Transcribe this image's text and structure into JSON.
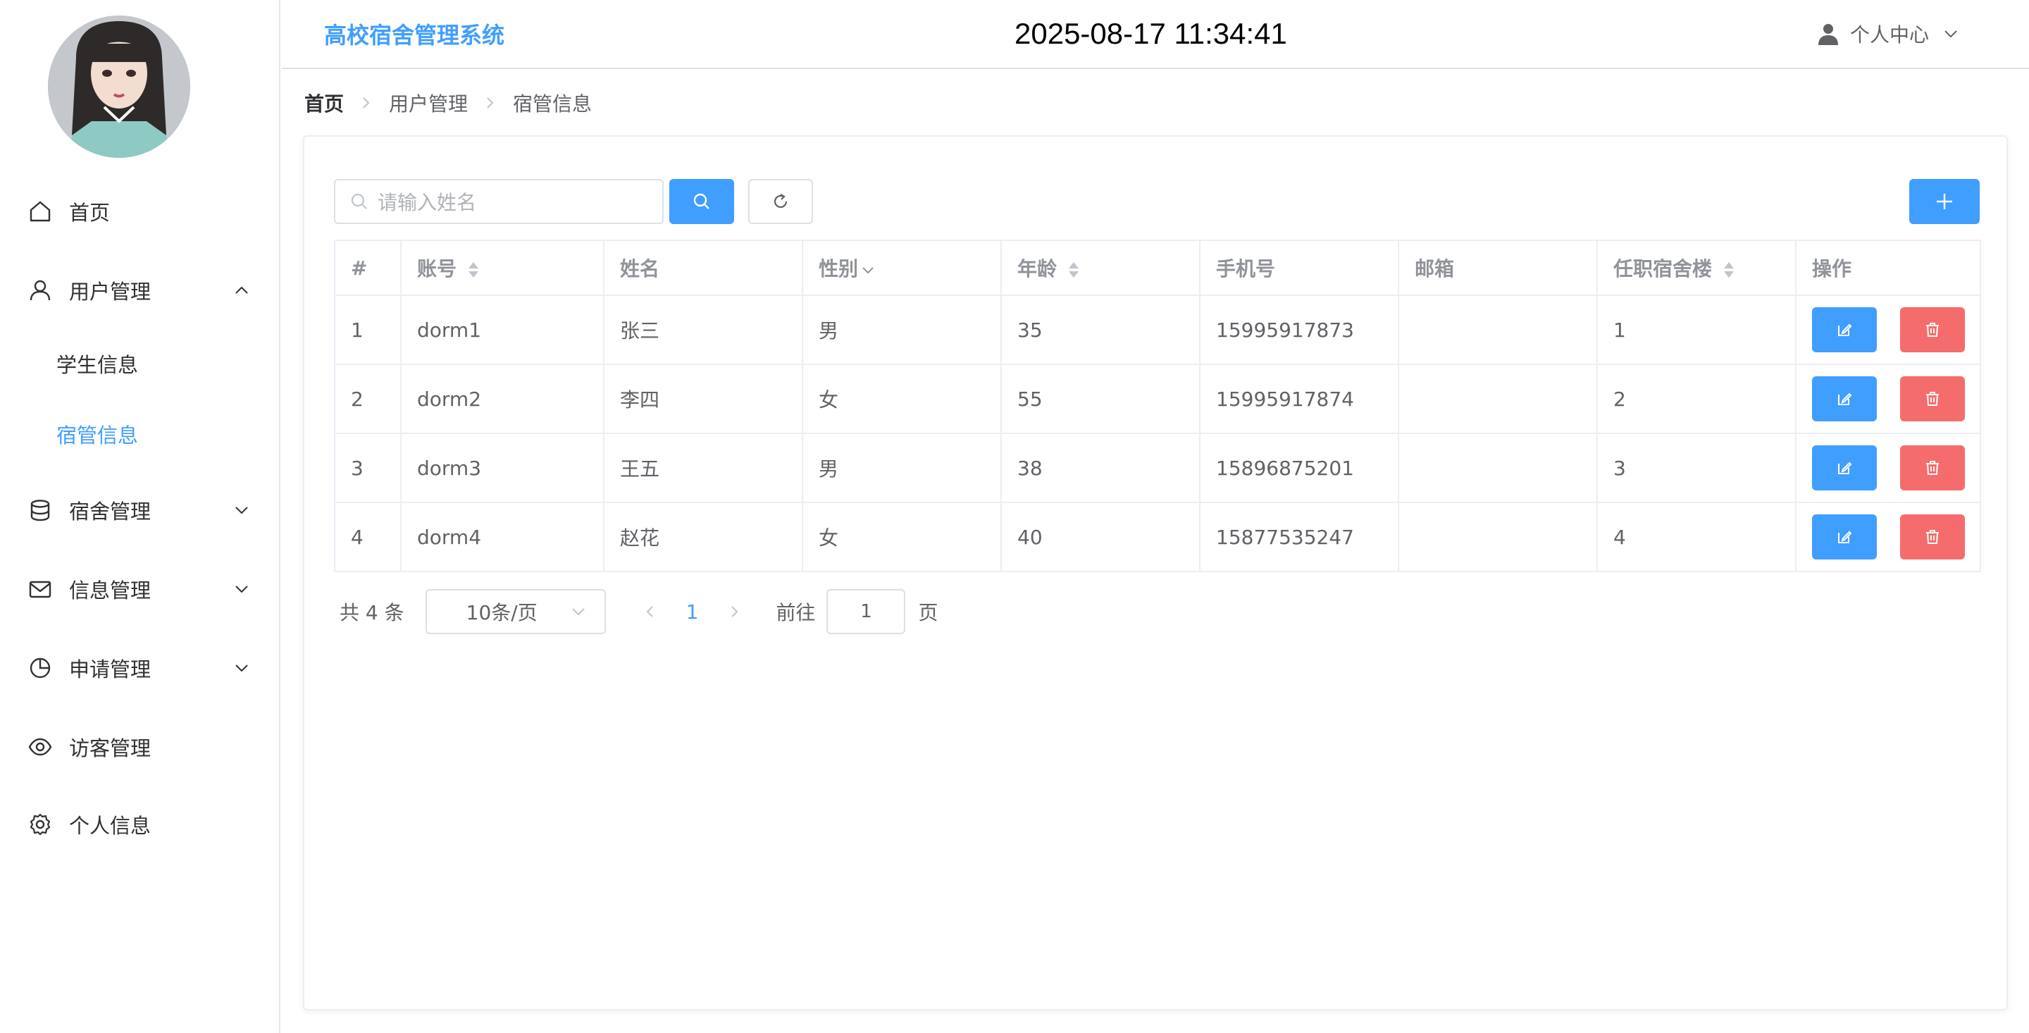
{
  "header": {
    "app_title": "高校宿舍管理系统",
    "clock": "2025-08-17 11:34:41",
    "user_menu": "个人中心"
  },
  "sidebar": {
    "items": [
      {
        "label": "首页",
        "icon": "home-icon"
      },
      {
        "label": "用户管理",
        "icon": "user-icon",
        "expanded": true
      },
      {
        "label": "宿舍管理",
        "icon": "database-icon"
      },
      {
        "label": "信息管理",
        "icon": "mail-icon"
      },
      {
        "label": "申请管理",
        "icon": "pie-chart-icon"
      },
      {
        "label": "访客管理",
        "icon": "eye-icon"
      },
      {
        "label": "个人信息",
        "icon": "gear-icon"
      }
    ],
    "sub_items": [
      {
        "label": "学生信息",
        "active": false
      },
      {
        "label": "宿管信息",
        "active": true
      }
    ]
  },
  "breadcrumb": {
    "home": "首页",
    "level1": "用户管理",
    "level2": "宿管信息"
  },
  "toolbar": {
    "search_placeholder": "请输入姓名",
    "search_value": ""
  },
  "table": {
    "columns": [
      "#",
      "账号",
      "姓名",
      "性别",
      "年龄",
      "手机号",
      "邮箱",
      "任职宿舍楼",
      "操作"
    ],
    "rows": [
      {
        "index": "1",
        "account": "dorm1",
        "name": "张三",
        "gender": "男",
        "age": "35",
        "phone": "15995917873",
        "email": "",
        "building": "1"
      },
      {
        "index": "2",
        "account": "dorm2",
        "name": "李四",
        "gender": "女",
        "age": "55",
        "phone": "15995917874",
        "email": "",
        "building": "2"
      },
      {
        "index": "3",
        "account": "dorm3",
        "name": "王五",
        "gender": "男",
        "age": "38",
        "phone": "15896875201",
        "email": "",
        "building": "3"
      },
      {
        "index": "4",
        "account": "dorm4",
        "name": "赵花",
        "gender": "女",
        "age": "40",
        "phone": "15877535247",
        "email": "",
        "building": "4"
      }
    ]
  },
  "pagination": {
    "total": "共 4 条",
    "page_size": "10条/页",
    "current_page": "1",
    "goto_label": "前往",
    "goto_value": "1",
    "page_unit": "页"
  },
  "colors": {
    "primary": "#409eff",
    "danger": "#f56c6c"
  }
}
